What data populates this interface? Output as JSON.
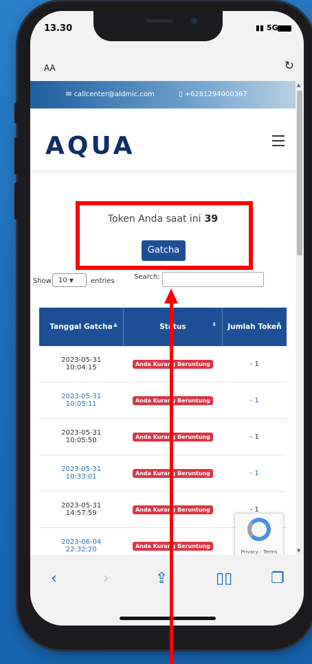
{
  "status": {
    "time": "13.30",
    "signal": "5G"
  },
  "address_bar": {
    "aa": "AA"
  },
  "topbar": {
    "email": "callcenter@aldmic.com",
    "phone": "+6281294000367"
  },
  "logo": "AQUA",
  "token": {
    "text": "Token Anda saat ini",
    "count": "39"
  },
  "button": {
    "gatcha": "Gatcha"
  },
  "controls": {
    "show": "Show",
    "entries_value": "10",
    "entries": "entries",
    "search": "Search:"
  },
  "table": {
    "headers": [
      "Tanggal Gatcha",
      "Status",
      "Jumlah Token"
    ],
    "rows": [
      {
        "date": "2023-05-31",
        "time": "10:04:15",
        "status": "Anda Kurang Beruntung",
        "token": "- 1"
      },
      {
        "date": "2023-05-31",
        "time": "10:05:11",
        "status": "Anda Kurang Beruntung",
        "token": "- 1"
      },
      {
        "date": "2023-05-31",
        "time": "10:05:50",
        "status": "Anda Kurang Beruntung",
        "token": "- 1"
      },
      {
        "date": "2023-05-31",
        "time": "10:33:01",
        "status": "Anda Kurang Beruntung",
        "token": "- 1"
      },
      {
        "date": "2023-05-31",
        "time": "14:57:59",
        "status": "Anda Kurang Beruntung",
        "token": "- 1"
      },
      {
        "date": "2023-06-04",
        "time": "22:32:20",
        "status": "Anda Kurang Beruntung",
        "token": ""
      }
    ]
  },
  "recaptcha": {
    "label": "Privacy - Terms"
  },
  "colors": {
    "brand": "#1e4f96",
    "annotation": "#ff0000",
    "badge": "#dc3545"
  }
}
